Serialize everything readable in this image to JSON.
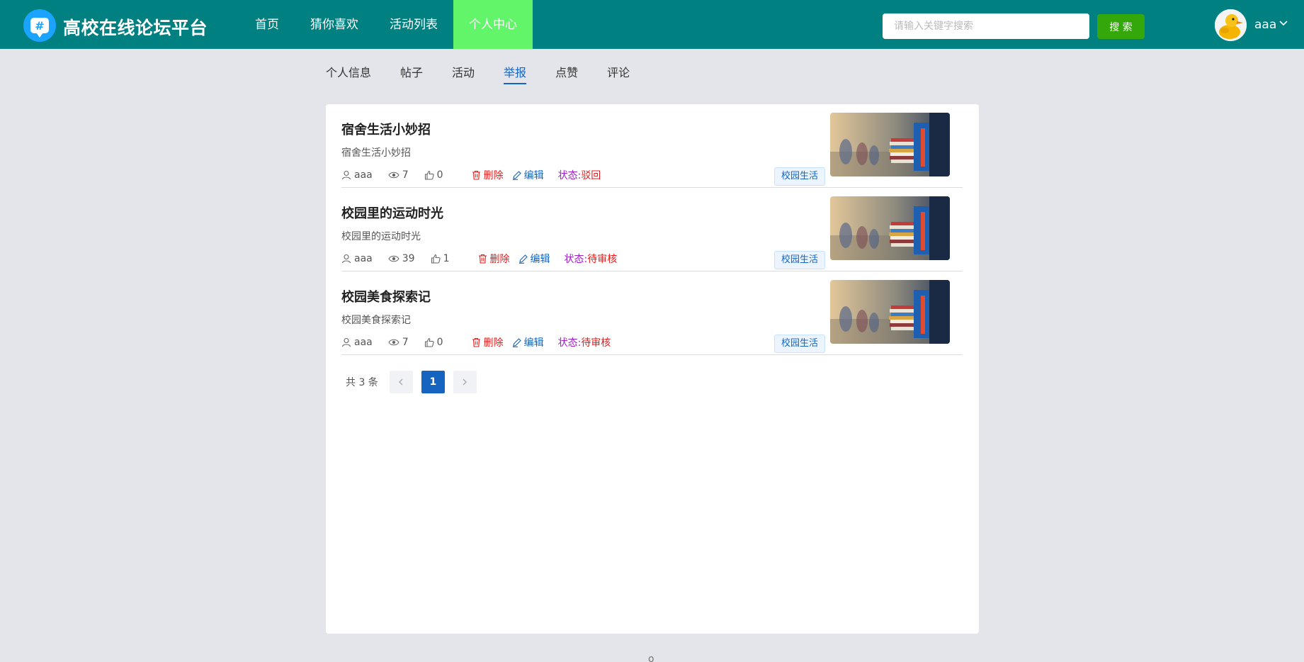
{
  "header": {
    "site_title": "高校在线论坛平台",
    "logo_symbol": "#",
    "nav": [
      "首页",
      "猜你喜欢",
      "活动列表",
      "个人中心"
    ],
    "active_nav": "个人中心",
    "search_placeholder": "请输入关键字搜索",
    "search_button": "搜 索",
    "username": "aaa"
  },
  "tabs": [
    "个人信息",
    "帖子",
    "活动",
    "举报",
    "点赞",
    "评论"
  ],
  "active_tab": "举报",
  "items": [
    {
      "title": "宿舍生活小妙招",
      "desc": "宿舍生活小妙招",
      "author": "aaa",
      "views": "7",
      "likes": "0",
      "delete_label": "删除",
      "edit_label": "编辑",
      "status_label": "状态:",
      "status_value": "驳回",
      "tag": "校园生活"
    },
    {
      "title": "校园里的运动时光",
      "desc": "校园里的运动时光",
      "author": "aaa",
      "views": "39",
      "likes": "1",
      "delete_label": "删除",
      "edit_label": "编辑",
      "status_label": "状态:",
      "status_value": "待审核",
      "tag": "校园生活"
    },
    {
      "title": "校园美食探索记",
      "desc": "校园美食探索记",
      "author": "aaa",
      "views": "7",
      "likes": "0",
      "delete_label": "删除",
      "edit_label": "编辑",
      "status_label": "状态:",
      "status_value": "待审核",
      "tag": "校园生活"
    }
  ],
  "pagination": {
    "total_label": "共 3 条",
    "current_page": "1"
  },
  "footer_text": "o",
  "colors": {
    "header": "#008080",
    "active_nav": "#62f56a",
    "search_button": "#34a80b",
    "primary": "#1565c0",
    "danger": "#e01b1b",
    "status_label": "#a020c8",
    "page_bg": "#e4e5ea"
  },
  "icons": {
    "logo": "chat-hash-icon",
    "user": "user-icon",
    "views": "eye-icon",
    "likes": "thumb-up-icon",
    "delete": "trash-icon",
    "edit": "pencil-icon",
    "dropdown": "chevron-down-icon",
    "prev": "chevron-left-icon",
    "next": "chevron-right-icon"
  }
}
